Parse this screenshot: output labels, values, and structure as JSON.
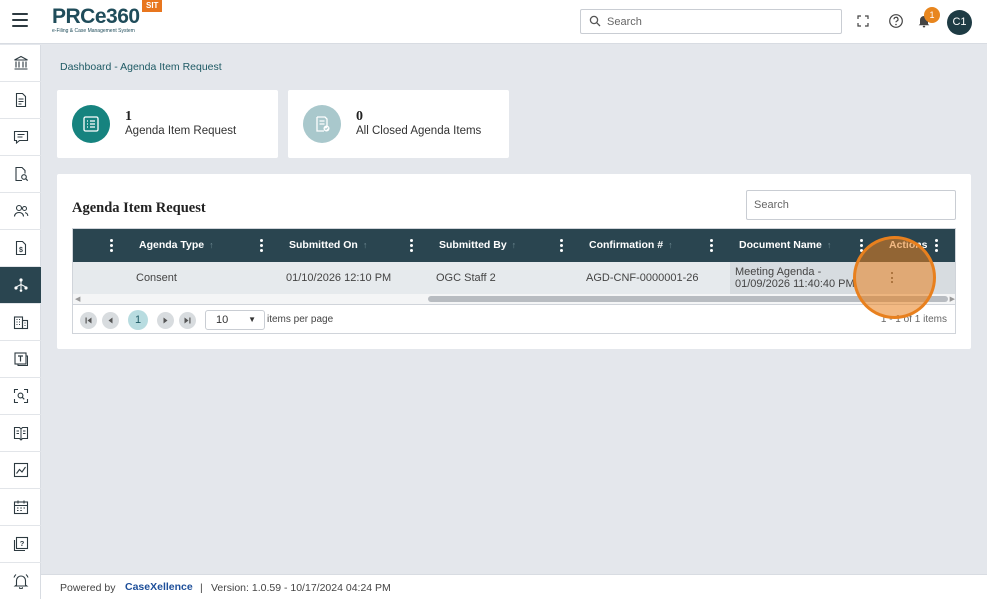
{
  "header": {
    "logo_title": "PRCe360",
    "logo_subtitle": "e-Filing & Case Management System",
    "env_badge": "SIT",
    "search_placeholder": "Search",
    "notification_count": "1",
    "avatar_initials": "C1"
  },
  "sidebar": {
    "items": [
      {
        "icon": "bank-icon"
      },
      {
        "icon": "document-icon"
      },
      {
        "icon": "chat-icon"
      },
      {
        "icon": "document-search-icon"
      },
      {
        "icon": "users-icon"
      },
      {
        "icon": "dollar-document-icon"
      },
      {
        "icon": "workflow-icon",
        "active": true
      },
      {
        "icon": "building-icon"
      },
      {
        "icon": "template-icon"
      },
      {
        "icon": "scan-icon"
      },
      {
        "icon": "book-icon"
      },
      {
        "icon": "chart-icon"
      },
      {
        "icon": "calendar-icon"
      },
      {
        "icon": "help-book-icon"
      },
      {
        "icon": "bell-icon"
      }
    ]
  },
  "breadcrumb": "Dashboard - Agenda Item Request",
  "stats": [
    {
      "count": "1",
      "label": "Agenda Item Request"
    },
    {
      "count": "0",
      "label": "All Closed Agenda Items"
    }
  ],
  "panel": {
    "title": "Agenda Item Request",
    "search_placeholder": "Search"
  },
  "grid": {
    "columns": [
      "Agenda Type",
      "Submitted On",
      "Submitted By",
      "Confirmation #",
      "Document Name",
      "Actions"
    ],
    "rows": [
      {
        "agenda_type": "Consent",
        "submitted_on": "01/10/2026 12:10 PM",
        "submitted_by": "OGC Staff 2",
        "confirmation": "AGD-CNF-0000001-26",
        "document_name_1": "Meeting Agenda -",
        "document_name_2": "01/09/2026 11:40:40 PM"
      }
    ]
  },
  "pager": {
    "current_page": "1",
    "page_size": "10",
    "page_size_label": "items per page",
    "info": "1 - 1 of 1 items"
  },
  "footer": {
    "powered_by": "Powered by",
    "brand": "CaseXellence",
    "separator": "|",
    "version": "Version: 1.0.59 - 10/17/2024 04:24 PM"
  },
  "colors": {
    "primary_dark": "#2a4550",
    "teal": "#16837f",
    "teal_light": "#a9c8cc",
    "accent_orange": "#e8801e"
  }
}
